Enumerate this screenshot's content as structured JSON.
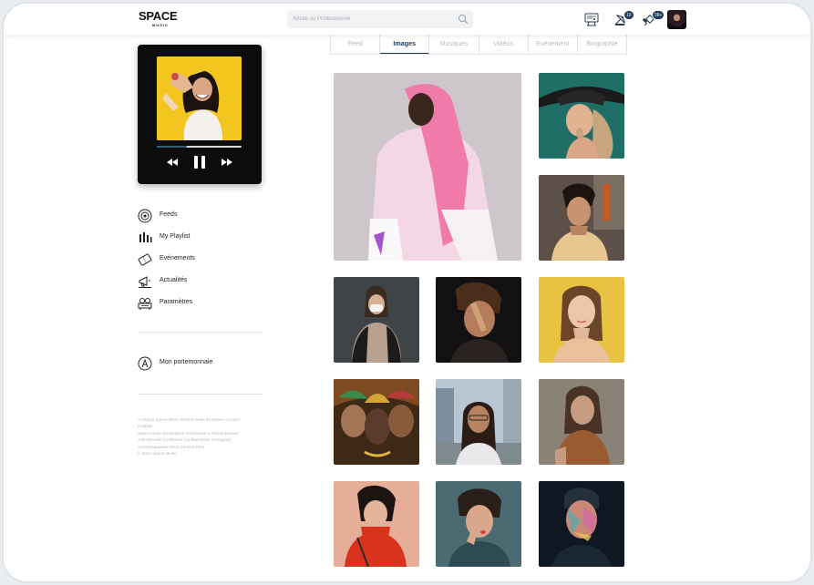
{
  "app": {
    "logo_main": "SPACE",
    "logo_sub": "MUSIC"
  },
  "search": {
    "placeholder": "Artiste ou Professionnel"
  },
  "header": {
    "notif_badge": "10",
    "messages_badge": "99+"
  },
  "tabs": [
    {
      "label": "Feed",
      "active": false
    },
    {
      "label": "Images",
      "active": true
    },
    {
      "label": "Musiques",
      "active": false
    },
    {
      "label": "Vidéos",
      "active": false
    },
    {
      "label": "Evénement",
      "active": false
    },
    {
      "label": "Biographie",
      "active": false
    }
  ],
  "player": {
    "progress": 0.35,
    "colors": {
      "progress": "#2f5e78",
      "track": "#d7d7d7"
    }
  },
  "sidebar": {
    "items": [
      {
        "label": "Feeds",
        "icon": "disc-icon"
      },
      {
        "label": "My Playlist",
        "icon": "equalizer-icon"
      },
      {
        "label": "Evénements",
        "icon": "ticket-icon"
      },
      {
        "label": "Actualités",
        "icon": "megaphone-icon"
      },
      {
        "label": "Paramètres",
        "icon": "settings-icon"
      }
    ],
    "wallet_label": "Mon portemonnaie"
  },
  "footer": {
    "lines": [
      "A propos Space Music Emisso Salle de presse Contact",
      "Emplois",
      "Space Music Developers Transparency Recompenses",
      "Ads Sécurité Conditions Confidentialité Consignes",
      "communautaires Droit d'auteur Plus",
      "© 2022 Space Music"
    ]
  },
  "colors": {
    "accent": "#1f3c5a",
    "badge": "#1e3a5a"
  }
}
